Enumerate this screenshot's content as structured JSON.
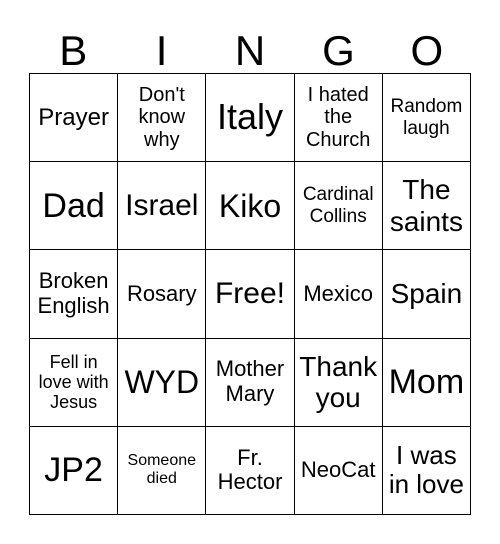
{
  "header": [
    "B",
    "I",
    "N",
    "G",
    "O"
  ],
  "cells": [
    "Prayer",
    "Don't know why",
    "Italy",
    "I hated the Church",
    "Random laugh",
    "Dad",
    "Israel",
    "Kiko",
    "Cardinal Collins",
    "The saints",
    "Broken English",
    "Rosary",
    "Free!",
    "Mexico",
    "Spain",
    "Fell in love with Jesus",
    "WYD",
    "Mother Mary",
    "Thank you",
    "Mom",
    "JP2",
    "Someone died",
    "Fr. Hector",
    "NeoCat",
    "I was in love"
  ]
}
